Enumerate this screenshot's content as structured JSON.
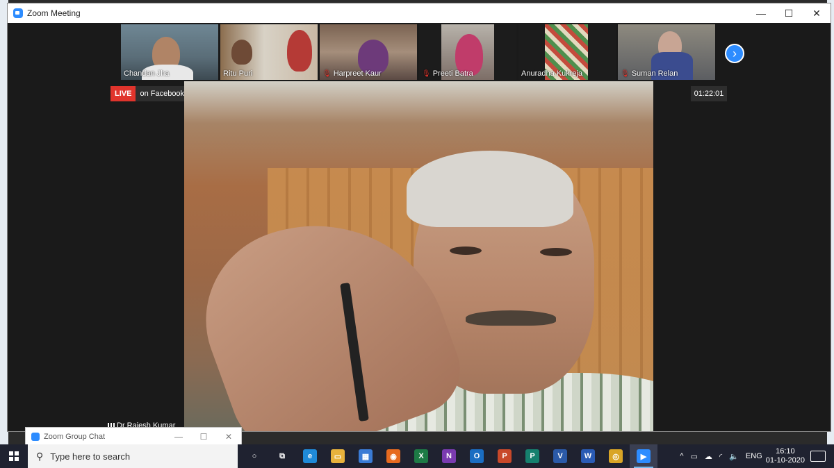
{
  "window": {
    "title": "Zoom Meeting",
    "controls": {
      "minimize": "—",
      "maximize": "☐",
      "close": "✕"
    }
  },
  "participants": [
    {
      "name": "Chandan Jha",
      "muted": false
    },
    {
      "name": "Ritu Puri",
      "muted": false
    },
    {
      "name": "Harpreet Kaur",
      "muted": true
    },
    {
      "name": "Preeti Batra",
      "muted": true
    },
    {
      "name": "Anuradha Kukreja",
      "muted": false
    },
    {
      "name": "Suman Relan",
      "muted": true
    }
  ],
  "next_page_icon": "chevron-right-icon",
  "live": {
    "tag": "LIVE",
    "text": "on Facebook"
  },
  "timer": "01:22:01",
  "speaker": {
    "name": "Dr Rajesh Kumar"
  },
  "group_chat": {
    "title": "Zoom Group Chat",
    "minimize": "—",
    "maximize": "☐",
    "close": "✕"
  },
  "taskbar": {
    "search_placeholder": "Type here to search",
    "apps": [
      {
        "name": "cortana-icon",
        "label": "○",
        "color": "transparent"
      },
      {
        "name": "task-view-icon",
        "label": "⧉",
        "color": "transparent"
      },
      {
        "name": "edge-icon",
        "label": "e",
        "color": "#1f8ad8"
      },
      {
        "name": "file-explorer-icon",
        "label": "▭",
        "color": "#e8b33c"
      },
      {
        "name": "store-icon",
        "label": "▦",
        "color": "#3a7bd5"
      },
      {
        "name": "firefox-icon",
        "label": "◉",
        "color": "#e66a1f"
      },
      {
        "name": "excel-icon",
        "label": "X",
        "color": "#1d7a45"
      },
      {
        "name": "onenote-icon",
        "label": "N",
        "color": "#7a3bb0"
      },
      {
        "name": "outlook-icon",
        "label": "O",
        "color": "#1a6dc2"
      },
      {
        "name": "powerpoint-icon",
        "label": "P",
        "color": "#c8482a"
      },
      {
        "name": "publisher-icon",
        "label": "P",
        "color": "#16806e"
      },
      {
        "name": "visio-icon",
        "label": "V",
        "color": "#2b5aa8"
      },
      {
        "name": "word-icon",
        "label": "W",
        "color": "#2a5bb4"
      },
      {
        "name": "chrome-icon",
        "label": "◎",
        "color": "#d9a526"
      },
      {
        "name": "zoom-icon",
        "label": "▶",
        "color": "#2d8cff"
      }
    ],
    "tray": {
      "lang": "ENG",
      "time": "16:10",
      "date": "01-10-2020"
    }
  }
}
